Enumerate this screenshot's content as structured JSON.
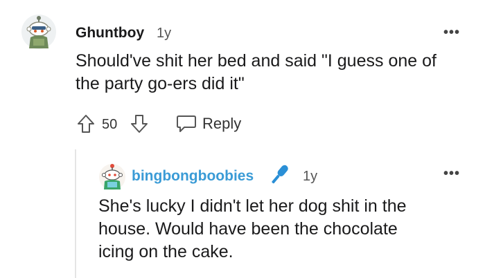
{
  "comment": {
    "username": "Ghuntboy",
    "age": "1y",
    "text_line1": "Should've shit her bed and said \"I guess one of",
    "text_line2": "the party go-ers did it\"",
    "score": "50",
    "reply_label": "Reply",
    "more_label": "•••",
    "avatar_icon": "snoo-avatar-icon"
  },
  "reply": {
    "username": "bingbongboobies",
    "age": "1y",
    "badge_icon": "microphone-icon",
    "text_line1": "She's lucky I didn't let her dog shit in the",
    "text_line2": "house. Would have been the chocolate",
    "text_line3": "icing on the cake.",
    "more_label": "•••",
    "avatar_icon": "snoo-avatar-icon"
  },
  "colors": {
    "reply_username": "#3a9bd6",
    "badge": "#2a8fd6",
    "thread_line": "#e5e5e5"
  }
}
